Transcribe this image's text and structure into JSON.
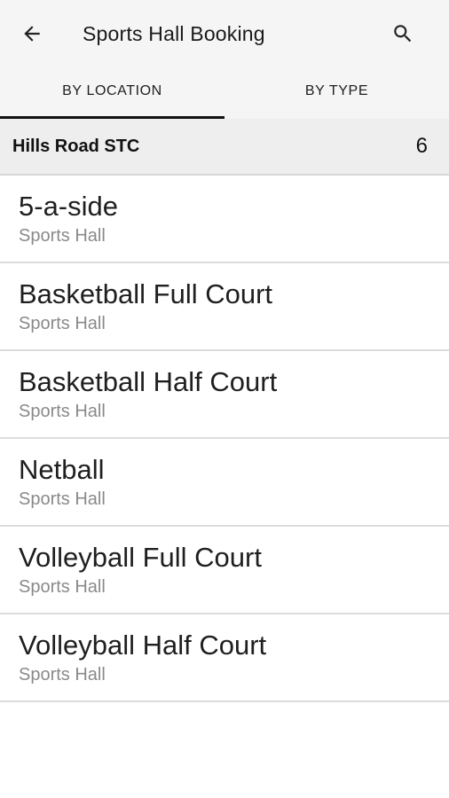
{
  "app_bar": {
    "title": "Sports Hall Booking",
    "back_icon": "arrow-left-icon",
    "search_icon": "search-icon"
  },
  "tabs": [
    {
      "label": "BY LOCATION",
      "active": true
    },
    {
      "label": "BY TYPE",
      "active": false
    }
  ],
  "section": {
    "name": "Hills Road STC",
    "count": "6"
  },
  "facilities": [
    {
      "name": "5-a-side",
      "location": "Sports Hall"
    },
    {
      "name": "Basketball Full Court",
      "location": "Sports Hall"
    },
    {
      "name": "Basketball Half Court",
      "location": "Sports Hall"
    },
    {
      "name": "Netball",
      "location": "Sports Hall"
    },
    {
      "name": "Volleyball Full Court",
      "location": "Sports Hall"
    },
    {
      "name": "Volleyball Half Court",
      "location": "Sports Hall"
    }
  ],
  "colors": {
    "app_bar_bg": "#f5f5f5",
    "tab_indicator": "#111111",
    "section_bg": "#eeeeee"
  }
}
